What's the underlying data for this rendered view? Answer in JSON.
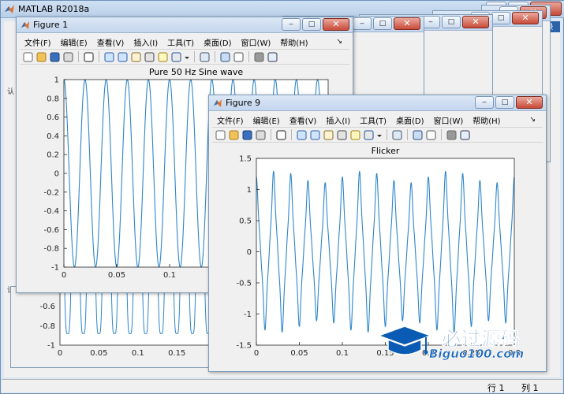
{
  "main_window": {
    "title": "MATLAB R2018a",
    "close_glyph": "✕",
    "max_glyph": "□",
    "min_glyph": "‒",
    "right_tab_label": "录",
    "left_glyph_1": "认",
    "left_glyph_2": "试",
    "status_row_label": "行  1",
    "status_col_label": "列  1"
  },
  "figure_menu": {
    "file": "文件(F)",
    "edit": "编辑(E)",
    "view": "查看(V)",
    "insert": "插入(I)",
    "tools": "工具(T)",
    "desktop": "桌面(D)",
    "window": "窗口(W)",
    "help": "帮助(H)",
    "dock_glyph": "↘"
  },
  "window_buttons": {
    "min": "‒",
    "max": "□",
    "close": "✕"
  },
  "figure1": {
    "title": "Figure 1",
    "plot_title": "Pure 50 Hz Sine wave"
  },
  "figure9": {
    "title": "Figure 9",
    "plot_title": "Flicker"
  },
  "watermark": {
    "text": "必过源码",
    "url": "Biguo100.com"
  },
  "colors": {
    "line": "#2e86c9",
    "accent": "#0a5bb3"
  },
  "chart_data": [
    {
      "type": "line",
      "title": "Pure 50 Hz Sine wave",
      "xlabel": "",
      "ylabel": "",
      "xlim": [
        0,
        0.25
      ],
      "ylim": [
        -1,
        1
      ],
      "x_ticks": [
        "0",
        "0.05",
        "0.1",
        "0.15",
        "0.2"
      ],
      "y_ticks": [
        "1",
        "0.8",
        "0.6",
        "0.4",
        "0.2",
        "0",
        "-0.2",
        "-0.4",
        "-0.6",
        "-0.8",
        "-1"
      ],
      "series": [
        {
          "frequency_hz": 50,
          "amplitude": 1
        }
      ]
    },
    {
      "type": "line",
      "title": "Flicker",
      "xlabel": "",
      "ylabel": "",
      "xlim": [
        0,
        0.3
      ],
      "ylim": [
        -1.5,
        1.5
      ],
      "x_ticks": [
        "0",
        "0.05",
        "0.1",
        "0.15",
        "0.2",
        "0.25",
        "0.3"
      ],
      "y_ticks": [
        "1.5",
        "1",
        "0.5",
        "0",
        "-0.5",
        "-1",
        "-1.5"
      ],
      "series": [
        {
          "frequency_hz": 50,
          "amplitude": 1,
          "harmonics": [
            {
              "order": 3,
              "amplitude": 0.15
            },
            {
              "order": 5,
              "amplitude": 0.05
            }
          ],
          "flicker_hz": 10,
          "flicker_amplitude": 0.08
        }
      ]
    },
    {
      "type": "line",
      "title": "",
      "xlim": [
        0,
        0.25
      ],
      "ylim": [
        -1,
        -0.4
      ],
      "x_ticks": [
        "0",
        "0.05",
        "0.1",
        "0.15",
        "0.2"
      ],
      "y_ticks": [
        "-0.6",
        "-0.8",
        "-1"
      ],
      "series": [
        {
          "frequency_hz": 50,
          "amplitude": 1
        }
      ]
    }
  ]
}
